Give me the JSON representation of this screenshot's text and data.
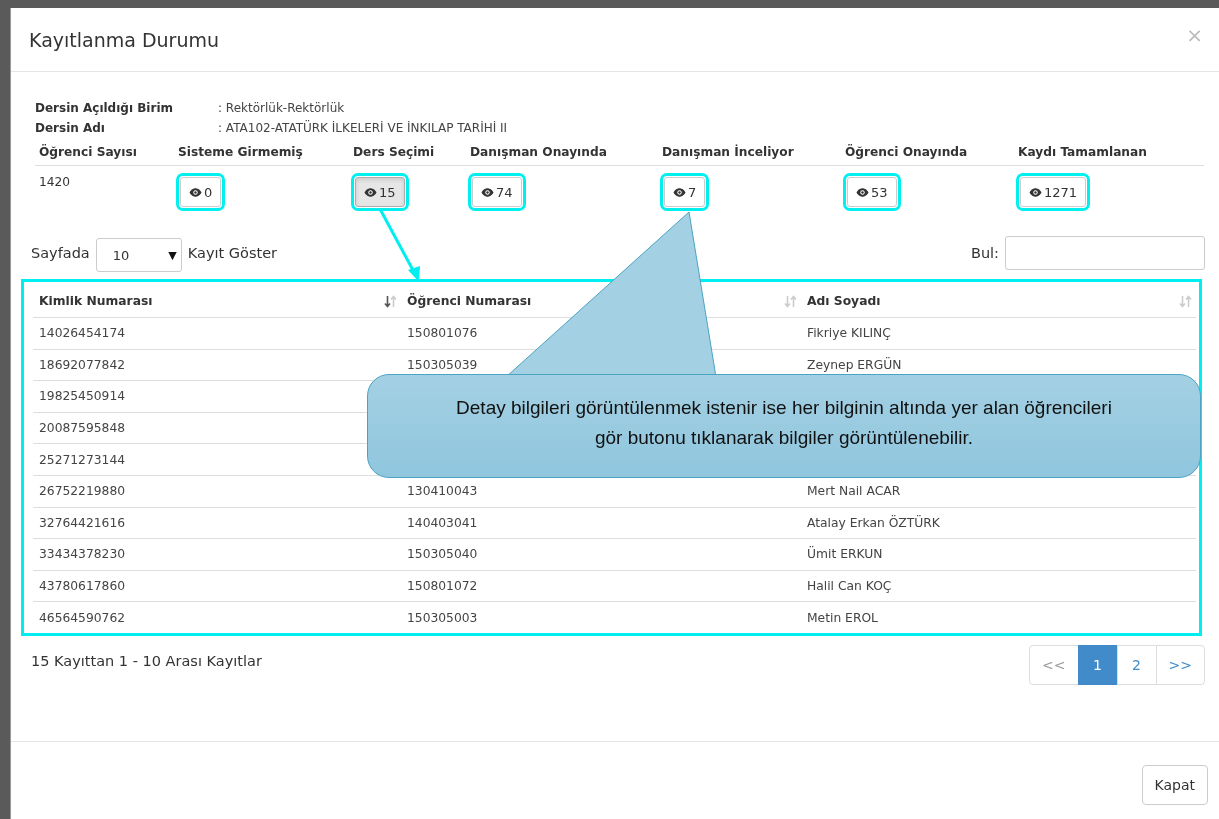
{
  "window": {
    "title": "Kayıtlanma Durumu",
    "close": "×"
  },
  "course_info": [
    {
      "label": "Dersin Açıldığı Birim",
      "value": ": Rektörlük-Rektörlük"
    },
    {
      "label": "Dersin Adı",
      "value": ": ATA102-ATATÜRK İLKELERİ VE İNKILAP TARİHİ II"
    }
  ],
  "stats": {
    "total_label": "Öğrenci Sayısı",
    "total_value": "1420",
    "statuses": [
      {
        "label": "Sisteme Girmemiş",
        "count": "0",
        "pressed": false
      },
      {
        "label": "Ders Seçimi",
        "count": "15",
        "pressed": true
      },
      {
        "label": "Danışman Onayında",
        "count": "74",
        "pressed": false
      },
      {
        "label": "Danışman İnceliyor",
        "count": "7",
        "pressed": false
      },
      {
        "label": "Öğrenci Onayında",
        "count": "53",
        "pressed": false
      },
      {
        "label": "Kaydı Tamamlanan",
        "count": "1271",
        "pressed": false
      }
    ]
  },
  "length_menu": {
    "before": "Sayfada",
    "value": "10",
    "caret": "▼",
    "after": "Kayıt Göster"
  },
  "search": {
    "label": "Bul:"
  },
  "table": {
    "columns": [
      {
        "label": "Kimlik Numarası",
        "sorted": true
      },
      {
        "label": "Öğrenci Numarası",
        "sorted": false
      },
      {
        "label": "Adı Soyadı",
        "sorted": false
      }
    ],
    "rows": [
      [
        "14026454174",
        "150801076",
        "Fikriye KILINÇ"
      ],
      [
        "18692077842",
        "150305039",
        "Zeynep ERGÜN"
      ],
      [
        "19825450914"
      ],
      [
        "20087595848"
      ],
      [
        "25271273144"
      ],
      [
        "26752219880",
        "130410043",
        "Mert Nail ACAR"
      ],
      [
        "32764421616",
        "140403041",
        "Atalay Erkan ÖZTÜRK"
      ],
      [
        "33434378230",
        "150305040",
        "Ümit ERKUN"
      ],
      [
        "43780617860",
        "150801072",
        "Halil Can KOÇ"
      ],
      [
        "46564590762",
        "150305003",
        "Metin EROL"
      ]
    ]
  },
  "info": "15 Kayıttan 1 - 10 Arası Kayıtlar",
  "pagination": [
    {
      "label": "<<",
      "selected": false
    },
    {
      "label": "1",
      "selected": true
    },
    {
      "label": "2",
      "selected": false
    },
    {
      "label": ">>",
      "selected": false
    }
  ],
  "footer_button": "Kapat",
  "annotation": {
    "text": "Detay bilgileri görüntülenmek istenir ise her bilginin altında yer alan öğrencileri gör butonu tıklanarak bilgiler görüntülenebilir."
  }
}
